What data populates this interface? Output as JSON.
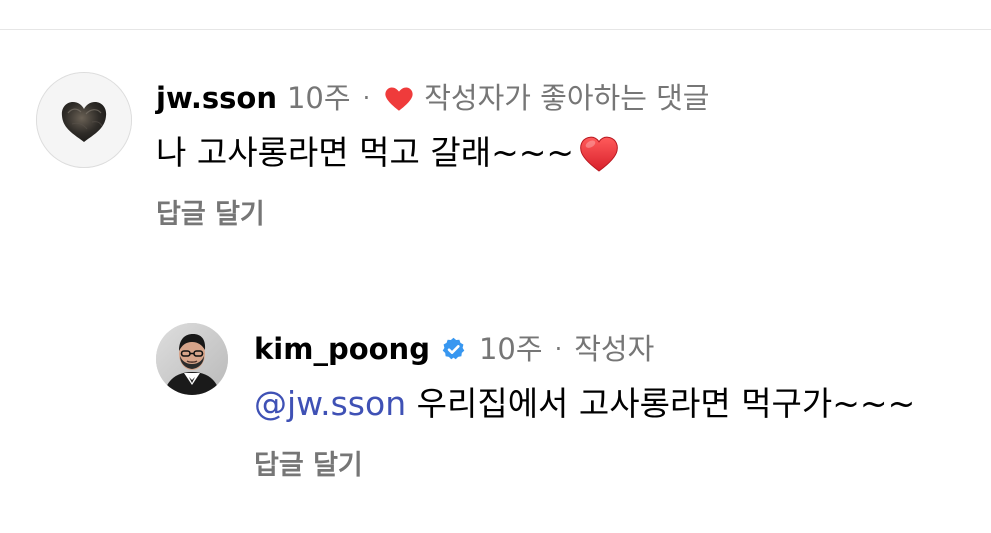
{
  "comments": [
    {
      "username": "jw.sson",
      "time": "10주",
      "separator": "·",
      "liked_by_creator_text": "작성자가 좋아하는 댓글",
      "text": "나 고사롱라면 먹고 갈래~~~",
      "emoji_icon": "red-heart-emoji",
      "reply_label": "답글 달기",
      "avatar_icon": "heart-pastry-avatar"
    },
    {
      "username": "kim_poong",
      "verified_icon": "verified-check-icon",
      "time": "10주",
      "separator": "·",
      "author_tag": "작성자",
      "mention": "@jw.sson",
      "text": "우리집에서 고사롱라면 먹구가~~~",
      "reply_label": "답글 달기",
      "avatar_icon": "portrait-avatar"
    }
  ],
  "colors": {
    "background": "#ffffff",
    "primary_text": "#000000",
    "secondary_text": "#767676",
    "mention": "#3f51b5",
    "heart": "#ef3b3b",
    "verified": "#3897f0",
    "divider": "#e6e6e6"
  }
}
